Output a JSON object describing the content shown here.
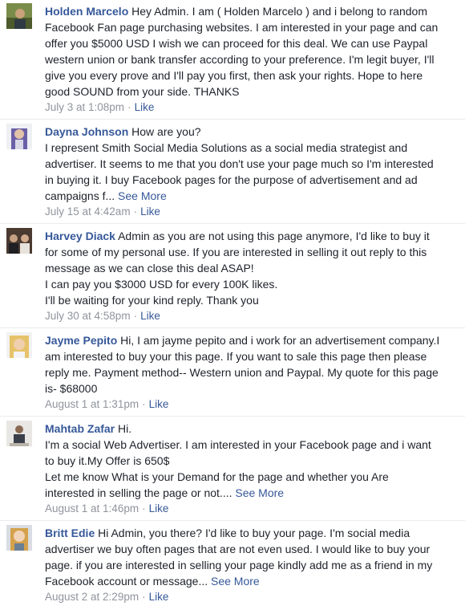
{
  "comments": [
    {
      "author": "Holden Marcelo",
      "first_line": "Hey Admin. I am ( Holden Marcelo ) and i belong to random",
      "lines": [
        "Facebook Fan page purchasing websites. I am interested in your page and can",
        "offer you $5000 USD I wish we can proceed for this deal. We can use Paypal",
        "western union or bank transfer according to your preference. I'm legit buyer, I'll",
        "give you every prove and I'll pay you first, then ask your rights. Hope to here",
        "good SOUND from your side. THANKS"
      ],
      "see_more": "",
      "timestamp": "July 3 at 1:08pm",
      "separator": "·",
      "like": "Like"
    },
    {
      "author": "Dayna Johnson",
      "first_line": "How are you?",
      "lines": [
        "I represent Smith Social Media Solutions as a social media strategist and",
        "advertiser. It seems to me that you don't use your page much so I'm interested",
        "in buying it. I buy Facebook pages for the purpose of advertisement and ad",
        "campaigns f..."
      ],
      "see_more": "See More",
      "timestamp": "July 15 at 4:42am",
      "separator": "·",
      "like": "Like"
    },
    {
      "author": "Harvey Diack",
      "first_line": "Admin as you are not using this page anymore, I'd like to buy it",
      "lines": [
        "for some of my personal use. If you are interested in selling it out reply to this",
        "message as we can close this deal ASAP!",
        "I can pay you $3000 USD for every 100K likes.",
        "I'll be waiting for your kind reply. Thank you"
      ],
      "see_more": "",
      "timestamp": "July 30 at 4:58pm",
      "separator": "·",
      "like": "Like"
    },
    {
      "author": "Jayme Pepito",
      "first_line": "Hi, I am jayme pepito and i work for an advertisement company.I",
      "lines": [
        "am interested to buy your this page. If you want to sale this page then please",
        "reply me. Payment method-- Western union and Paypal. My quote for this page",
        "is- $68000"
      ],
      "see_more": "",
      "timestamp": "August 1 at 1:31pm",
      "separator": "·",
      "like": "Like"
    },
    {
      "author": "Mahtab Zafar",
      "first_line": "Hi.",
      "lines": [
        "I'm a social Web Advertiser. I am interested in your Facebook page and i want",
        "to buy it.My Offer is 650$",
        "Let me know What is your Demand for the page and whether you Are",
        "interested in selling the page or not...."
      ],
      "see_more": "See More",
      "timestamp": "August 1 at 1:46pm",
      "separator": "·",
      "like": "Like"
    },
    {
      "author": "Britt Edie",
      "first_line": "Hi Admin, you there? I'd like to buy your page. I'm social media",
      "lines": [
        "advertiser we buy often pages that are not even used. I would like to buy your",
        "page. if you are interested in selling your page kindly add me as a friend in my",
        "Facebook account or message..."
      ],
      "see_more": "See More",
      "timestamp": "August 2 at 2:29pm",
      "separator": "·",
      "like": "Like"
    }
  ]
}
